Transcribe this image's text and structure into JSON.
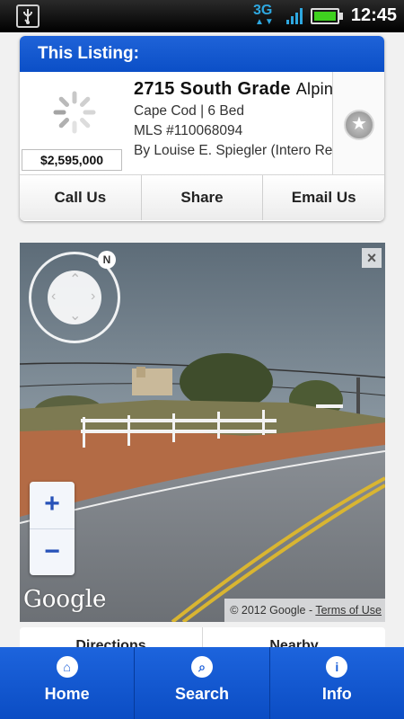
{
  "status_bar": {
    "network": "3G",
    "network_arrows": "▲▼",
    "time": "12:45",
    "battery_level": 1.0
  },
  "listing": {
    "header": "This Listing:",
    "address": "2715 South Grade",
    "address_city": "Alpine",
    "style_beds": "Cape Cod | 6 Bed",
    "mls": "MLS #110068094",
    "agent": "By Louise E. Spiegler (Intero Real Estate)",
    "price": "$2,595,000",
    "actions": [
      "Call Us",
      "Share",
      "Email Us"
    ]
  },
  "streetview": {
    "compass_north": "N",
    "close": "×",
    "zoom_in": "+",
    "zoom_out": "−",
    "logo": "Google",
    "copyright": "© 2012 Google - ",
    "terms": "Terms of Use"
  },
  "subtabs": [
    "Directions",
    "Nearby"
  ],
  "bottom_nav": [
    {
      "label": "Home",
      "icon": "home-icon",
      "glyph": "⌂"
    },
    {
      "label": "Search",
      "icon": "search-icon",
      "glyph": "⌕"
    },
    {
      "label": "Info",
      "icon": "info-icon",
      "glyph": "i"
    }
  ],
  "colors": {
    "brand_blue": "#1a5ed8",
    "battery_green": "#3fd21f",
    "network_blue": "#2ea8e0"
  }
}
